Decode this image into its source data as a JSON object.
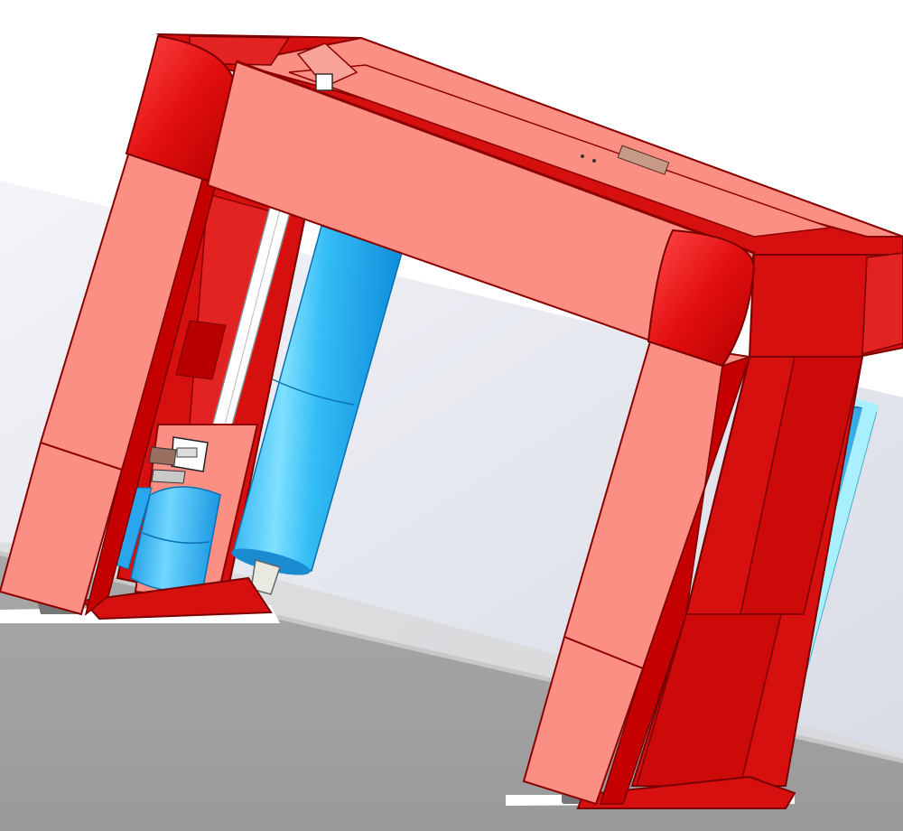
{
  "scene": {
    "subject": "cad-gantry-frame",
    "colors": {
      "frame_face": "#fb8f84",
      "frame_edge": "#8b0000",
      "frame_side": "#d60f0f",
      "frame_side_light": "#e32222",
      "roller_blue": "#2ab4f3",
      "roller_highlight": "#a9f0ff",
      "floor_gray": "#a0a0a0",
      "wall_light": "#dfe2ea",
      "background": "#ffffff"
    },
    "icons": [
      "cylinder-roller",
      "motor-unit",
      "wheel"
    ]
  }
}
